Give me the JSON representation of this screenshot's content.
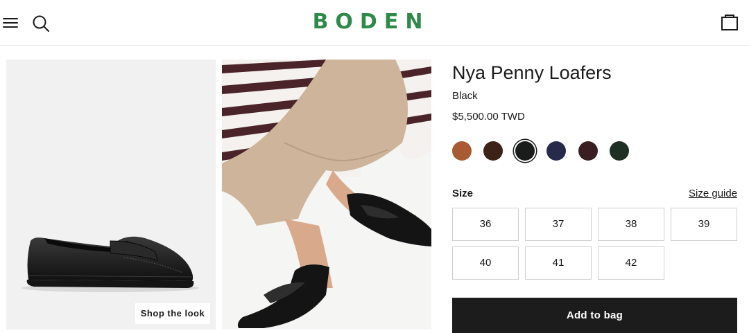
{
  "header": {
    "logo": "BODEN",
    "menu_icon": "menu-icon",
    "search_icon": "search-icon",
    "bag_icon": "bag-icon"
  },
  "gallery": {
    "shop_the_look": "Shop the look"
  },
  "product": {
    "title": "Nya Penny Loafers",
    "color": "Black",
    "price": "$5,500.00 TWD",
    "swatches": [
      {
        "name": "Tan",
        "hex": "#a85a32",
        "selected": false
      },
      {
        "name": "Dark Brown",
        "hex": "#3d2218",
        "selected": false
      },
      {
        "name": "Black",
        "hex": "#1a1c1c",
        "selected": true
      },
      {
        "name": "Navy",
        "hex": "#272a4a",
        "selected": false
      },
      {
        "name": "Burgundy",
        "hex": "#3a1f22",
        "selected": false
      },
      {
        "name": "Dark Green",
        "hex": "#1e2f24",
        "selected": false
      }
    ],
    "size_label": "Size",
    "size_guide": "Size guide",
    "sizes": [
      "36",
      "37",
      "38",
      "39",
      "40",
      "41",
      "42"
    ],
    "add_to_bag": "Add to bag"
  }
}
